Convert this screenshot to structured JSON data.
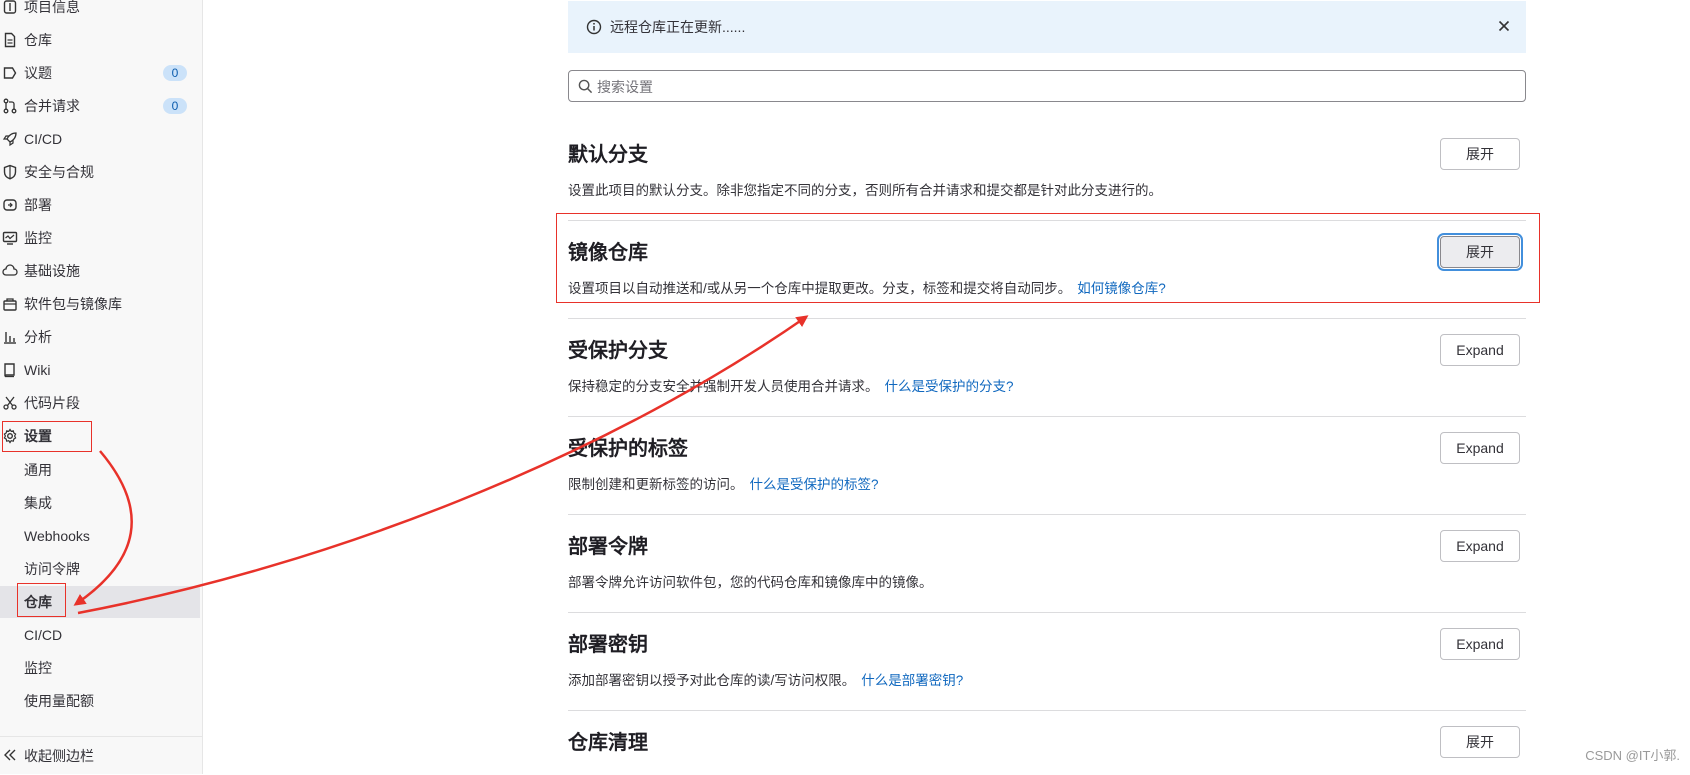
{
  "sidebar": {
    "items": [
      {
        "label": "项目信息",
        "icon": "project-info-icon"
      },
      {
        "label": "仓库",
        "icon": "repository-icon"
      },
      {
        "label": "议题",
        "icon": "issues-icon",
        "badge": "0"
      },
      {
        "label": "合并请求",
        "icon": "merge-request-icon",
        "badge": "0"
      },
      {
        "label": "CI/CD",
        "icon": "rocket-icon"
      },
      {
        "label": "安全与合规",
        "icon": "shield-icon"
      },
      {
        "label": "部署",
        "icon": "deploy-icon"
      },
      {
        "label": "监控",
        "icon": "monitor-icon"
      },
      {
        "label": "基础设施",
        "icon": "infrastructure-icon"
      },
      {
        "label": "软件包与镜像库",
        "icon": "package-icon"
      },
      {
        "label": "分析",
        "icon": "chart-icon"
      },
      {
        "label": "Wiki",
        "icon": "book-icon"
      },
      {
        "label": "代码片段",
        "icon": "scissors-icon"
      },
      {
        "label": "设置",
        "icon": "gear-icon"
      }
    ],
    "sub_items": [
      {
        "label": "通用"
      },
      {
        "label": "集成"
      },
      {
        "label": "Webhooks"
      },
      {
        "label": "访问令牌"
      },
      {
        "label": "仓库"
      },
      {
        "label": "CI/CD"
      },
      {
        "label": "监控"
      },
      {
        "label": "使用量配额"
      }
    ],
    "collapse_label": "收起侧边栏"
  },
  "alert": {
    "message": "远程仓库正在更新......"
  },
  "search": {
    "placeholder": "搜索设置"
  },
  "sections": [
    {
      "title": "默认分支",
      "desc": "设置此项目的默认分支。除非您指定不同的分支，否则所有合并请求和提交都是针对此分支进行的。",
      "link": "",
      "button": "展开"
    },
    {
      "title": "镜像仓库",
      "desc": "设置项目以自动推送和/或从另一个仓库中提取更改。分支，标签和提交将自动同步。",
      "link": "如何镜像仓库?",
      "button": "展开"
    },
    {
      "title": "受保护分支",
      "desc": "保持稳定的分支安全并强制开发人员使用合并请求。",
      "link": "什么是受保护的分支?",
      "button": "Expand"
    },
    {
      "title": "受保护的标签",
      "desc": "限制创建和更新标签的访问。",
      "link": "什么是受保护的标签?",
      "button": "Expand"
    },
    {
      "title": "部署令牌",
      "desc": "部署令牌允许访问软件包，您的代码仓库和镜像库中的镜像。",
      "link": "",
      "button": "Expand"
    },
    {
      "title": "部署密钥",
      "desc": "添加部署密钥以授予对此仓库的读/写访问权限。",
      "link": "什么是部署密钥?",
      "button": "Expand"
    },
    {
      "title": "仓库清理",
      "desc": "",
      "link": "",
      "button": "展开"
    }
  ],
  "watermark": "CSDN @IT小郭.",
  "colors": {
    "link": "#1068bf",
    "annotation_red": "#e8322a",
    "alert_bg": "#e9f3fc",
    "focus_ring": "#428fdc"
  }
}
